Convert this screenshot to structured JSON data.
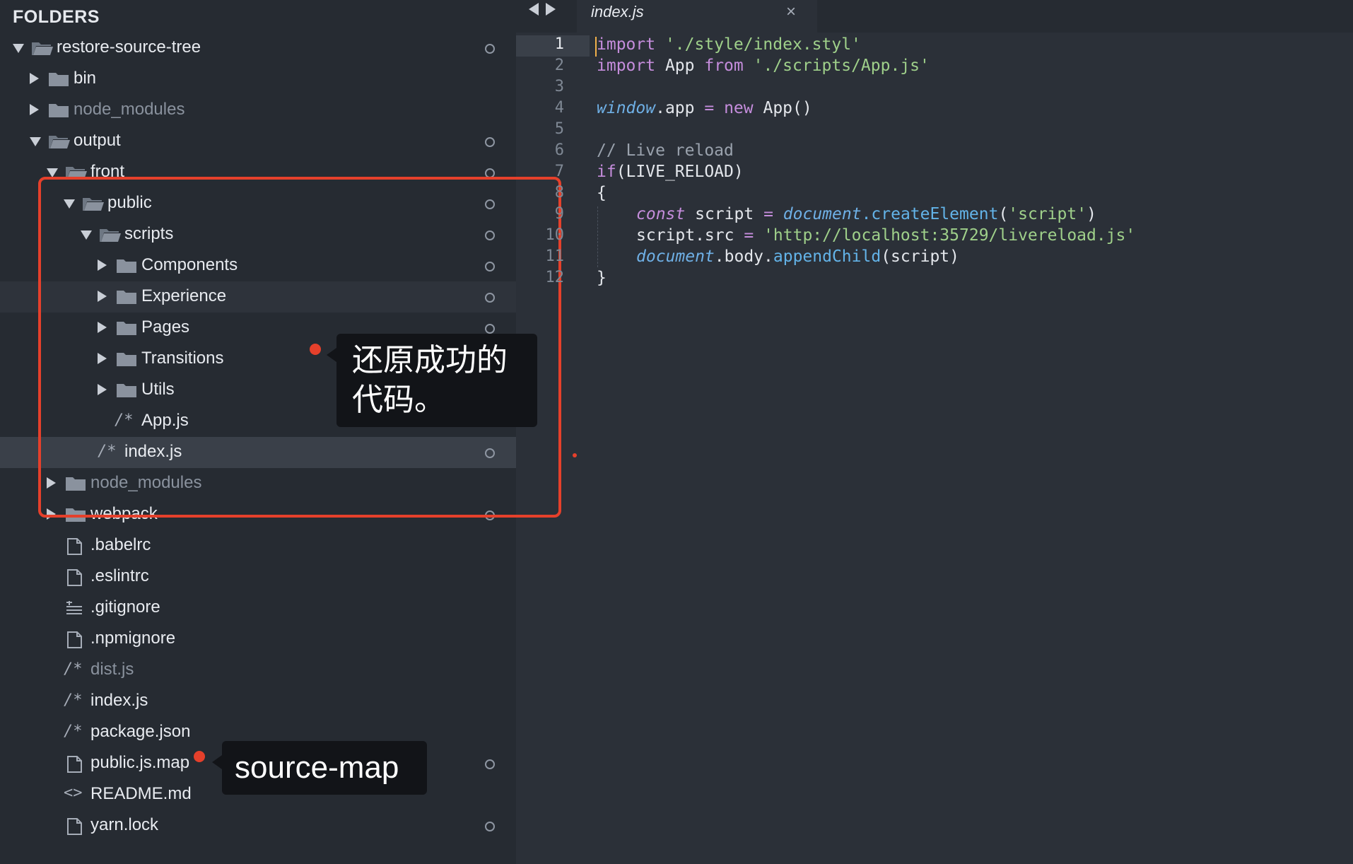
{
  "sidebar": {
    "title": "FOLDERS",
    "items": [
      {
        "label": "restore-source-tree",
        "type": "folder-open",
        "dim": false
      },
      {
        "label": "bin",
        "type": "folder",
        "dim": false
      },
      {
        "label": "node_modules",
        "type": "folder",
        "dim": true
      },
      {
        "label": "output",
        "type": "folder-open",
        "dim": false
      },
      {
        "label": "front",
        "type": "folder-open",
        "dim": false
      },
      {
        "label": "public",
        "type": "folder-open",
        "dim": false
      },
      {
        "label": "scripts",
        "type": "folder-open",
        "dim": false
      },
      {
        "label": "Components",
        "type": "folder",
        "dim": false
      },
      {
        "label": "Experience",
        "type": "folder",
        "dim": false
      },
      {
        "label": "Pages",
        "type": "folder",
        "dim": false
      },
      {
        "label": "Transitions",
        "type": "folder",
        "dim": false
      },
      {
        "label": "Utils",
        "type": "folder",
        "dim": false
      },
      {
        "label": "App.js",
        "type": "js-file",
        "dim": false
      },
      {
        "label": "index.js",
        "type": "js-file",
        "dim": false
      },
      {
        "label": "node_modules",
        "type": "folder",
        "dim": true
      },
      {
        "label": "webpack",
        "type": "folder",
        "dim": false
      },
      {
        "label": ".babelrc",
        "type": "file",
        "dim": false
      },
      {
        "label": ".eslintrc",
        "type": "file",
        "dim": false
      },
      {
        "label": ".gitignore",
        "type": "lines-file",
        "dim": false
      },
      {
        "label": ".npmignore",
        "type": "file",
        "dim": false
      },
      {
        "label": "dist.js",
        "type": "js-file",
        "dim": true
      },
      {
        "label": "index.js",
        "type": "js-file",
        "dim": false
      },
      {
        "label": "package.json",
        "type": "js-file",
        "dim": false
      },
      {
        "label": "public.js.map",
        "type": "file",
        "dim": false
      },
      {
        "label": "README.md",
        "type": "code-file",
        "dim": false
      },
      {
        "label": "yarn.lock",
        "type": "file",
        "dim": false
      }
    ]
  },
  "editor": {
    "tab_title": "index.js",
    "tab_close": "×",
    "line_numbers": [
      "1",
      "2",
      "3",
      "4",
      "5",
      "6",
      "7",
      "8",
      "9",
      "10",
      "11",
      "12"
    ],
    "code": {
      "l1_kw": "import",
      "l1_str": "'./style/index.styl'",
      "l2_kw": "import",
      "l2_plain": "App",
      "l2_kw2": "from",
      "l2_str": "'./scripts/App.js'",
      "l4_glob": "window",
      "l4_plain1": ".app",
      "l4_op": "=",
      "l4_kw": "new",
      "l4_plain2": "App()",
      "l6_cmt": "// Live reload",
      "l7_kw": "if",
      "l7_plain": "(LIVE_RELOAD)",
      "l8": "{",
      "l9_kw": "const",
      "l9_plain": "script",
      "l9_op": "=",
      "l9_glob": "document",
      "l9_fn": ".createElement",
      "l9_paren": "(",
      "l9_str": "'script'",
      "l9_end": ")",
      "l10_plain": "script.src",
      "l10_op": "=",
      "l10_str": "'http://localhost:35729/livereload.js'",
      "l11_glob": "document",
      "l11_plain": ".body.",
      "l11_fn": "appendChild",
      "l11_end": "(script)",
      "l12": "}"
    }
  },
  "annotations": {
    "callout1_line1": "还原成功的",
    "callout1_line2": "代码。",
    "callout2": "source-map"
  },
  "colors": {
    "accent_red": "#e5402b",
    "sidebar_bg": "#262b32",
    "editor_bg": "#2b3038"
  }
}
